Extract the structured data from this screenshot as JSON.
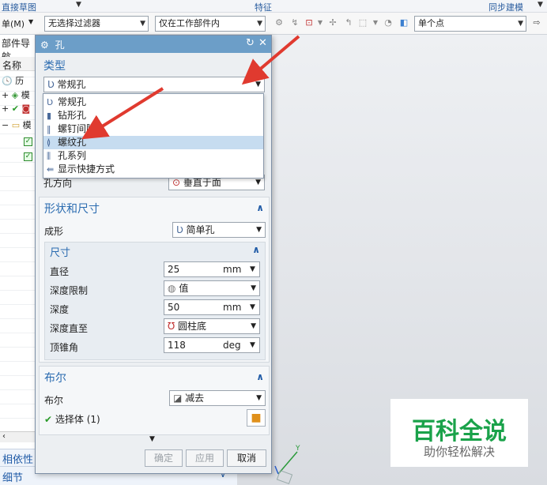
{
  "ribbon": {
    "group_left": "直接草图",
    "group_mid": "特征",
    "group_right": "同步建模"
  },
  "toolbar": {
    "menu_label": "单(M)",
    "filter_value": "无选择过滤器",
    "scope_value": "仅在工作部件内",
    "snap_value": "单个点"
  },
  "navigator": {
    "title": "部件导航",
    "header_name": "名称",
    "items": [
      "历",
      "模",
      "",
      "模"
    ],
    "dependency_label": "相依性",
    "details_label": "细节"
  },
  "dialog": {
    "title": "孔",
    "type_section": {
      "title": "类型",
      "selected": "常规孔",
      "options": [
        "常规孔",
        "钻形孔",
        "螺钉间隙孔",
        "螺纹孔",
        "孔系列",
        "显示快捷方式"
      ],
      "highlighted_option": "螺纹孔"
    },
    "direction": {
      "label": "孔方向",
      "value": "垂直于面"
    },
    "shape_section": {
      "title": "形状和尺寸",
      "form_label": "成形",
      "form_value": "简单孔",
      "dims_title": "尺寸",
      "diameter_label": "直径",
      "diameter_value": "25",
      "diameter_unit": "mm",
      "depth_limit_label": "深度限制",
      "depth_limit_value": "值",
      "depth_label": "深度",
      "depth_value": "50",
      "depth_unit": "mm",
      "depth_to_label": "深度直至",
      "depth_to_value": "圆柱底",
      "tip_angle_label": "顶锥角",
      "tip_angle_value": "118",
      "tip_angle_unit": "deg"
    },
    "boolean_section": {
      "title": "布尔",
      "label": "布尔",
      "value": "减去",
      "select_body": "选择体 (1)"
    },
    "buttons": {
      "ok": "确定",
      "apply": "应用",
      "cancel": "取消"
    }
  },
  "watermark": {
    "main": "百科全说",
    "sub": "助你轻松解决"
  },
  "colors": {
    "title_bar": "#6c9ec8",
    "section_title": "#2a6bb0",
    "highlight": "#c6dcf0",
    "arrow": "#e03a2f",
    "watermark_green": "#1aa24a"
  }
}
